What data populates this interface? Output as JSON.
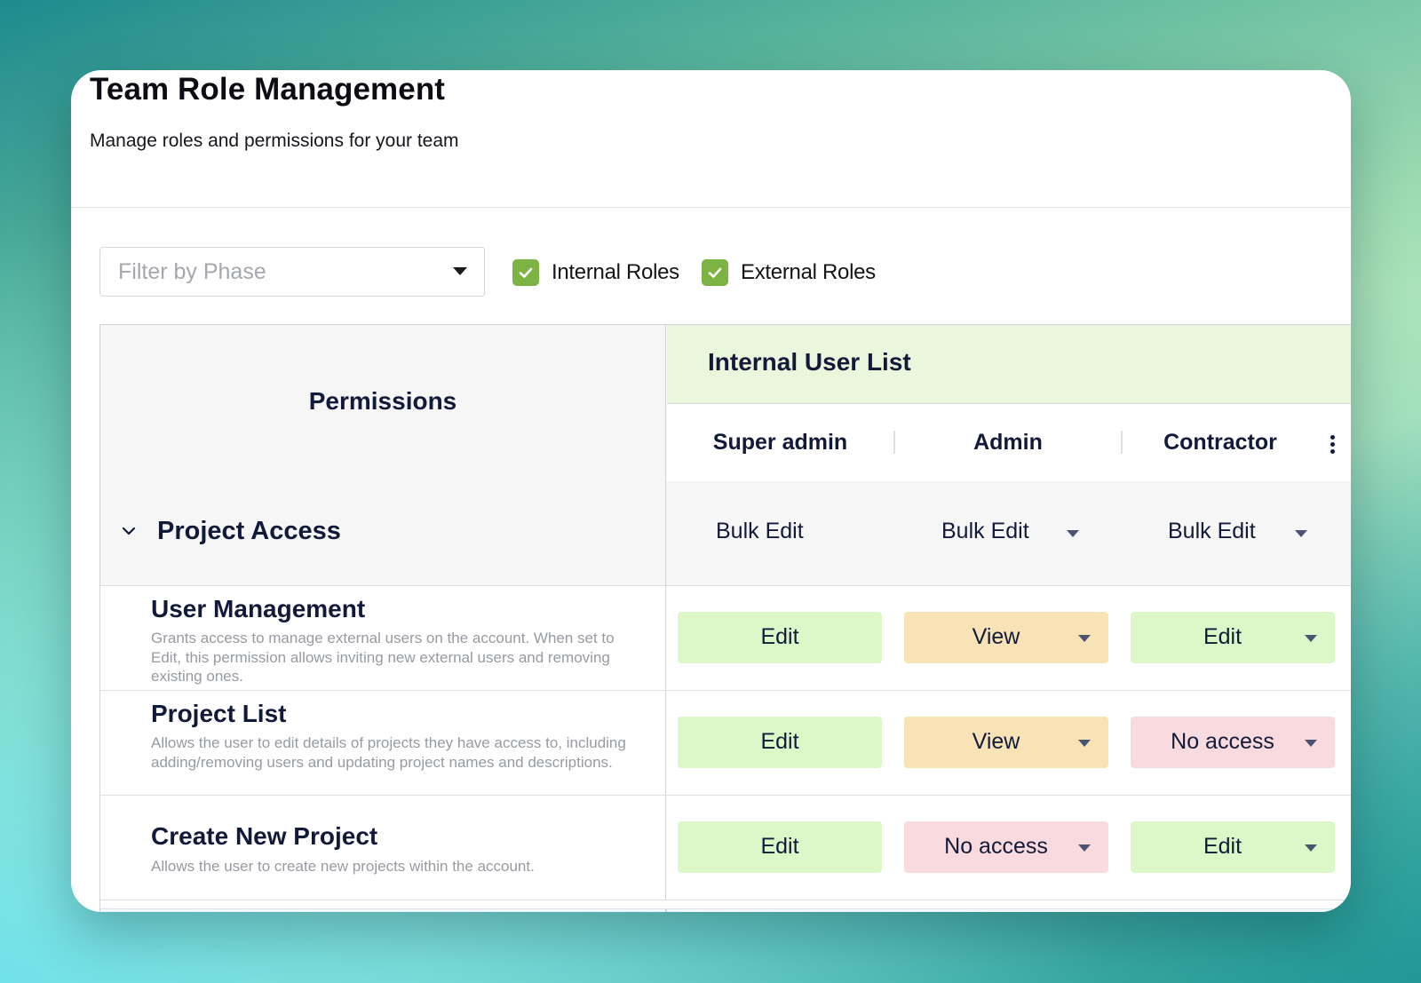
{
  "header": {
    "title": "Team Role Management",
    "subtitle": "Manage roles and permissions for your team"
  },
  "filters": {
    "phase_placeholder": "Filter by Phase",
    "internal_roles": {
      "label": "Internal Roles",
      "checked": true
    },
    "external_roles": {
      "label": "External Roles",
      "checked": true
    }
  },
  "table": {
    "permissions_header": "Permissions",
    "group_header": "Internal User List",
    "roles": [
      "Super admin",
      "Admin",
      "Contractor"
    ],
    "section": {
      "title": "Project Access",
      "bulk": [
        "Bulk Edit",
        "Bulk Edit",
        "Bulk Edit"
      ]
    },
    "rows": [
      {
        "title": "User Management",
        "description": "Grants access to manage external users on the account. When set to Edit, this permission allows inviting new external users and removing existing ones.",
        "values": [
          "Edit",
          "View",
          "Edit"
        ]
      },
      {
        "title": "Project List",
        "description": "Allows the user to edit details of projects they have access to, including adding/removing users and updating project names and descriptions.",
        "values": [
          "Edit",
          "View",
          "No access"
        ]
      },
      {
        "title": "Create New Project",
        "description": "Allows the user to create new projects within the account.",
        "values": [
          "Edit",
          "No access",
          "Edit"
        ]
      }
    ]
  },
  "colors": {
    "edit": "#dcf7c8",
    "view": "#f8e3b6",
    "no_access": "#f9dade",
    "checkbox": "#7cb342",
    "group_header_bg": "#eaf7dc"
  }
}
